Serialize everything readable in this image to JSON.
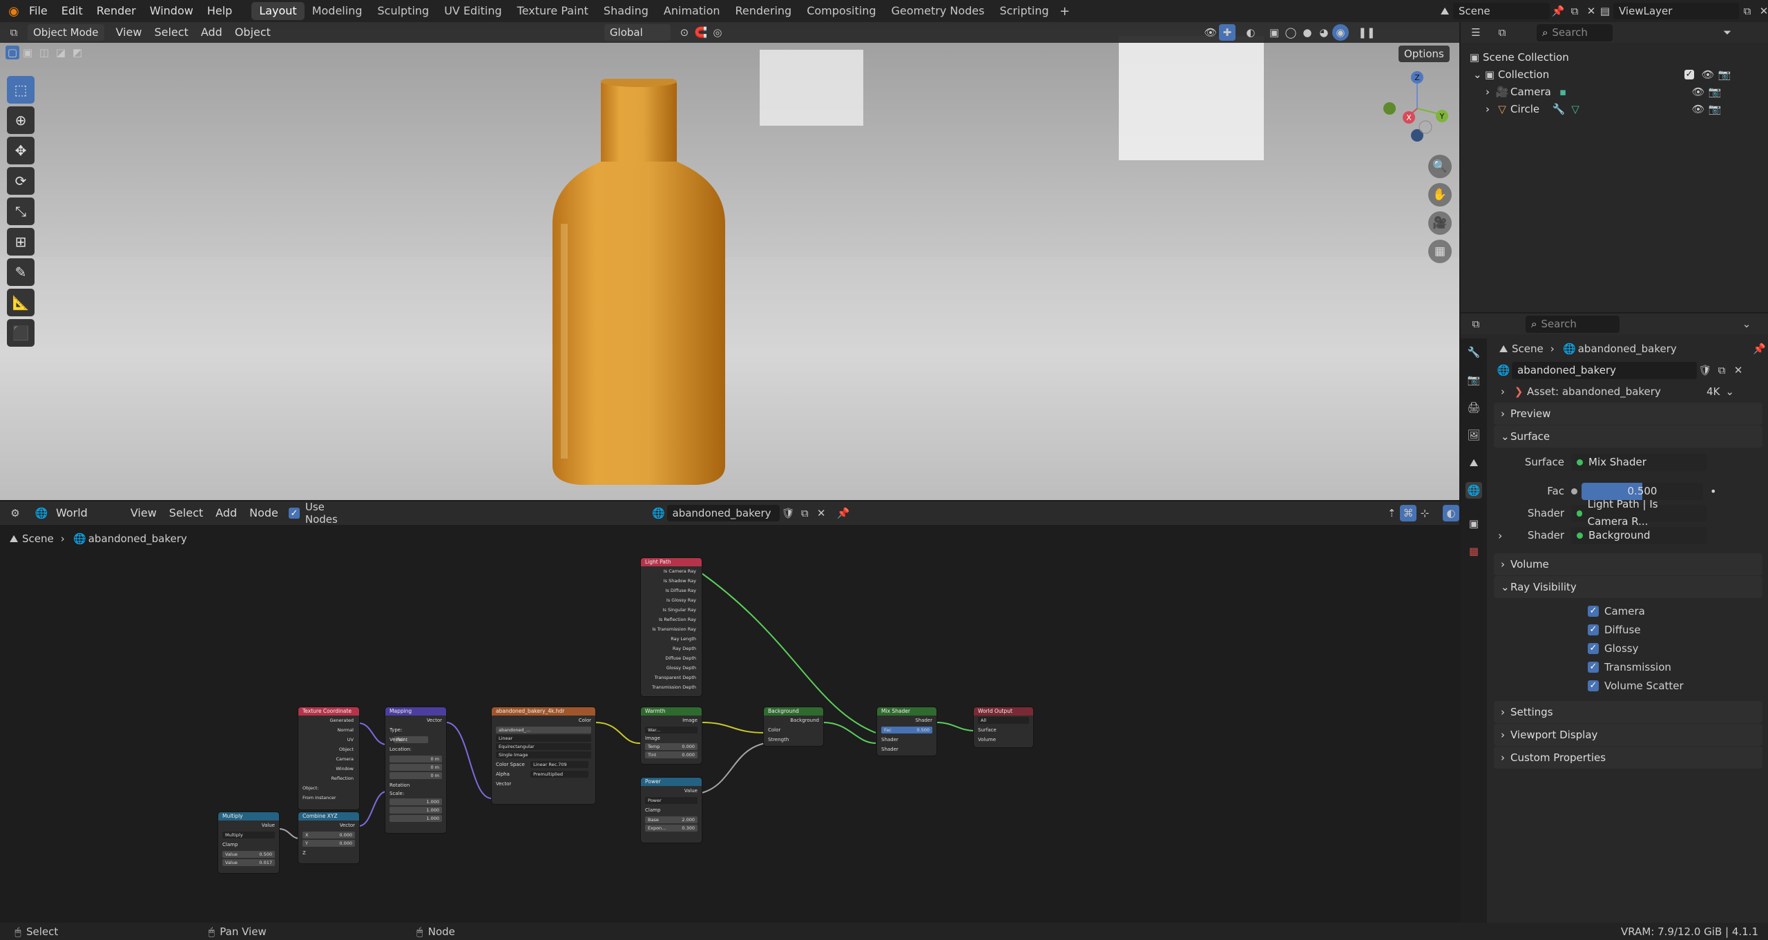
{
  "topbar": {
    "menus": [
      "File",
      "Edit",
      "Render",
      "Window",
      "Help"
    ],
    "workspaces": [
      "Layout",
      "Modeling",
      "Sculpting",
      "UV Editing",
      "Texture Paint",
      "Shading",
      "Animation",
      "Rendering",
      "Compositing",
      "Geometry Nodes",
      "Scripting"
    ],
    "active_workspace": "Layout",
    "scene": "Scene",
    "view_layer": "ViewLayer",
    "add_tab_icon": "plus-icon"
  },
  "viewport": {
    "mode": "Object Mode",
    "menus": [
      "View",
      "Select",
      "Add",
      "Object"
    ],
    "transform_orientation": "Global",
    "options_label": "Options",
    "gizmo": {
      "x": "X",
      "y": "Y",
      "z": "Z"
    }
  },
  "outliner": {
    "search_placeholder": "Search",
    "items": [
      {
        "label": "Scene Collection",
        "icon": "collection-icon"
      },
      {
        "label": "Collection",
        "icon": "collection-icon"
      },
      {
        "label": "Camera",
        "icon": "camera-icon"
      },
      {
        "label": "Circle",
        "icon": "mesh-icon"
      }
    ]
  },
  "properties": {
    "search_placeholder": "Search",
    "breadcrumb": [
      "Scene",
      "abandoned_bakery"
    ],
    "world_name": "abandoned_bakery",
    "asset_label": "Asset: abandoned_bakery",
    "resolution": "4K",
    "sections": {
      "preview": "Preview",
      "surface": "Surface",
      "volume": "Volume",
      "ray_visibility": "Ray Visibility",
      "settings": "Settings",
      "viewport_display": "Viewport Display",
      "custom_properties": "Custom Properties"
    },
    "surface_label": "Surface",
    "surface_value": "Mix Shader",
    "fac_label": "Fac",
    "fac_value": "0.500",
    "fac_fraction": 0.5,
    "shader1_label": "Shader",
    "shader1_value": "Light Path | Is Camera R...",
    "shader2_label": "Shader",
    "shader2_value": "Background",
    "ray_items": [
      "Camera",
      "Diffuse",
      "Glossy",
      "Transmission",
      "Volume Scatter"
    ]
  },
  "node_editor": {
    "editor_type": "World",
    "menus": [
      "View",
      "Select",
      "Add",
      "Node"
    ],
    "use_nodes_label": "Use Nodes",
    "world_name": "abandoned_bakery",
    "breadcrumb": [
      "Scene",
      "abandoned_bakery"
    ],
    "nodes": {
      "light_path": {
        "title": "Light Path",
        "outputs": [
          "Is Camera Ray",
          "Is Shadow Ray",
          "Is Diffuse Ray",
          "Is Glossy Ray",
          "Is Singular Ray",
          "Is Reflection Ray",
          "Is Transmission Ray",
          "Ray Length",
          "Ray Depth",
          "Diffuse Depth",
          "Glossy Depth",
          "Transparent Depth",
          "Transmission Depth"
        ]
      },
      "tex_coord": {
        "title": "Texture Coordinate",
        "outputs": [
          "Generated",
          "Normal",
          "UV",
          "Object",
          "Camera",
          "Window",
          "Reflection"
        ],
        "object_label": "Object:",
        "from_instancer": "From Instancer"
      },
      "mapping": {
        "title": "Mapping",
        "output": "Vector",
        "type_label": "Type:",
        "type_value": "Point",
        "vector_label": "Vector",
        "location_label": "Location:",
        "loc": [
          "0 m",
          "0 m",
          "0 m"
        ],
        "rotation_label": "Rotation",
        "scale_label": "Scale:",
        "scale": [
          "1.000",
          "1.000",
          "1.000"
        ],
        "axes": [
          "X",
          "Y",
          "Z"
        ]
      },
      "env_tex": {
        "title": "abandoned_bakery_4k.hdr",
        "output": "Color",
        "image_name": "abandoned_...",
        "interp": "Linear",
        "proj": "Equirectangular",
        "ext": "Single Image",
        "cs_label": "Color Space",
        "cs_value": "Linear Rec.709",
        "alpha_label": "Alpha",
        "alpha_value": "Premultiplied",
        "vector_label": "Vector"
      },
      "warmth": {
        "title": "Warmth",
        "output": "Image",
        "image_field": "War...",
        "image_in": "Image",
        "temp_label": "Temp",
        "temp_value": "0.000",
        "tint_label": "Tint",
        "tint_value": "0.000"
      },
      "power": {
        "title": "Power",
        "output": "Value",
        "op": "Power",
        "clamp": "Clamp",
        "base_label": "Base",
        "base_value": "2.000",
        "exp_label": "Expon...",
        "exp_value": "0.300"
      },
      "background": {
        "title": "Background",
        "output": "Background",
        "inputs": [
          "Color",
          "Strength"
        ]
      },
      "mix_shader": {
        "title": "Mix Shader",
        "output": "Shader",
        "fac_label": "Fac",
        "fac_value": "0.500",
        "inputs": [
          "Shader",
          "Shader"
        ]
      },
      "world_output": {
        "title": "World Output",
        "target": "All",
        "inputs": [
          "Surface",
          "Volume"
        ]
      },
      "multiply": {
        "title": "Multiply",
        "output": "Value",
        "op": "Multiply",
        "clamp": "Clamp",
        "v1_label": "Value",
        "v1_value": "0.500",
        "v2_label": "Value",
        "v2_value": "0.017"
      },
      "combine_xyz": {
        "title": "Combine XYZ",
        "output": "Vector",
        "x_label": "X",
        "x_value": "0.000",
        "y_label": "Y",
        "y_value": "0.000",
        "z_label": "Z"
      }
    }
  },
  "status": {
    "select": "Select",
    "pan": "Pan View",
    "node": "Node",
    "vram": "VRAM: 7.9/12.0 GiB | 4.1.1"
  }
}
